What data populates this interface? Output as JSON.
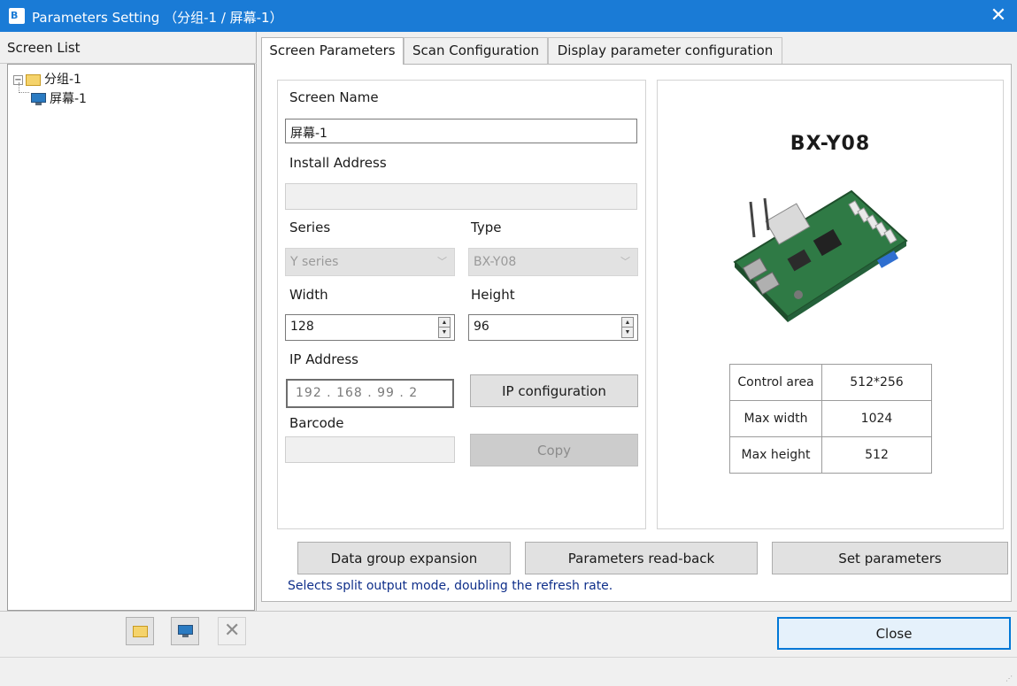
{
  "window": {
    "title": "Parameters Setting （分组-1 / 屏幕-1）",
    "app_icon_text": "B",
    "close_glyph": "✕"
  },
  "screen_list": {
    "header": "Screen List",
    "tree": [
      {
        "label": "分组-1",
        "type": "group",
        "expanded": true
      },
      {
        "label": "屏幕-1",
        "type": "screen",
        "selected": true
      }
    ]
  },
  "tabs": [
    {
      "label": "Screen Parameters",
      "active": true
    },
    {
      "label": "Scan Configuration",
      "active": false
    },
    {
      "label": "Display parameter configuration",
      "active": false
    }
  ],
  "form": {
    "screen_name_label": "Screen Name",
    "screen_name_value": "屏幕-1",
    "install_address_label": "Install Address",
    "install_address_value": "",
    "series_label": "Series",
    "series_value": "Y series",
    "type_label": "Type",
    "type_value": "BX-Y08",
    "width_label": "Width",
    "width_value": "128",
    "height_label": "Height",
    "height_value": "96",
    "ip_label": "IP Address",
    "ip_value": "192 . 168 . 99 . 2",
    "ip_config_button": "IP configuration",
    "barcode_label": "Barcode",
    "barcode_value": "",
    "copy_button": "Copy"
  },
  "controller": {
    "model": "BX-Y08",
    "specs": [
      {
        "key": "Control area",
        "value": "512*256"
      },
      {
        "key": "Max width",
        "value": "1024"
      },
      {
        "key": "Max height",
        "value": "512"
      }
    ]
  },
  "actions": {
    "data_group_expansion": "Data group expansion",
    "parameters_read_back": "Parameters read-back",
    "set_parameters": "Set parameters",
    "hint": "Selects split output mode, doubling the refresh rate."
  },
  "footer": {
    "close_button": "Close",
    "tools": [
      "add-group-icon",
      "add-screen-icon",
      "delete-icon"
    ]
  },
  "colors": {
    "titlebar": "#1a7bd6",
    "hint_text": "#0f2f8a",
    "primary_border": "#0078d7"
  }
}
